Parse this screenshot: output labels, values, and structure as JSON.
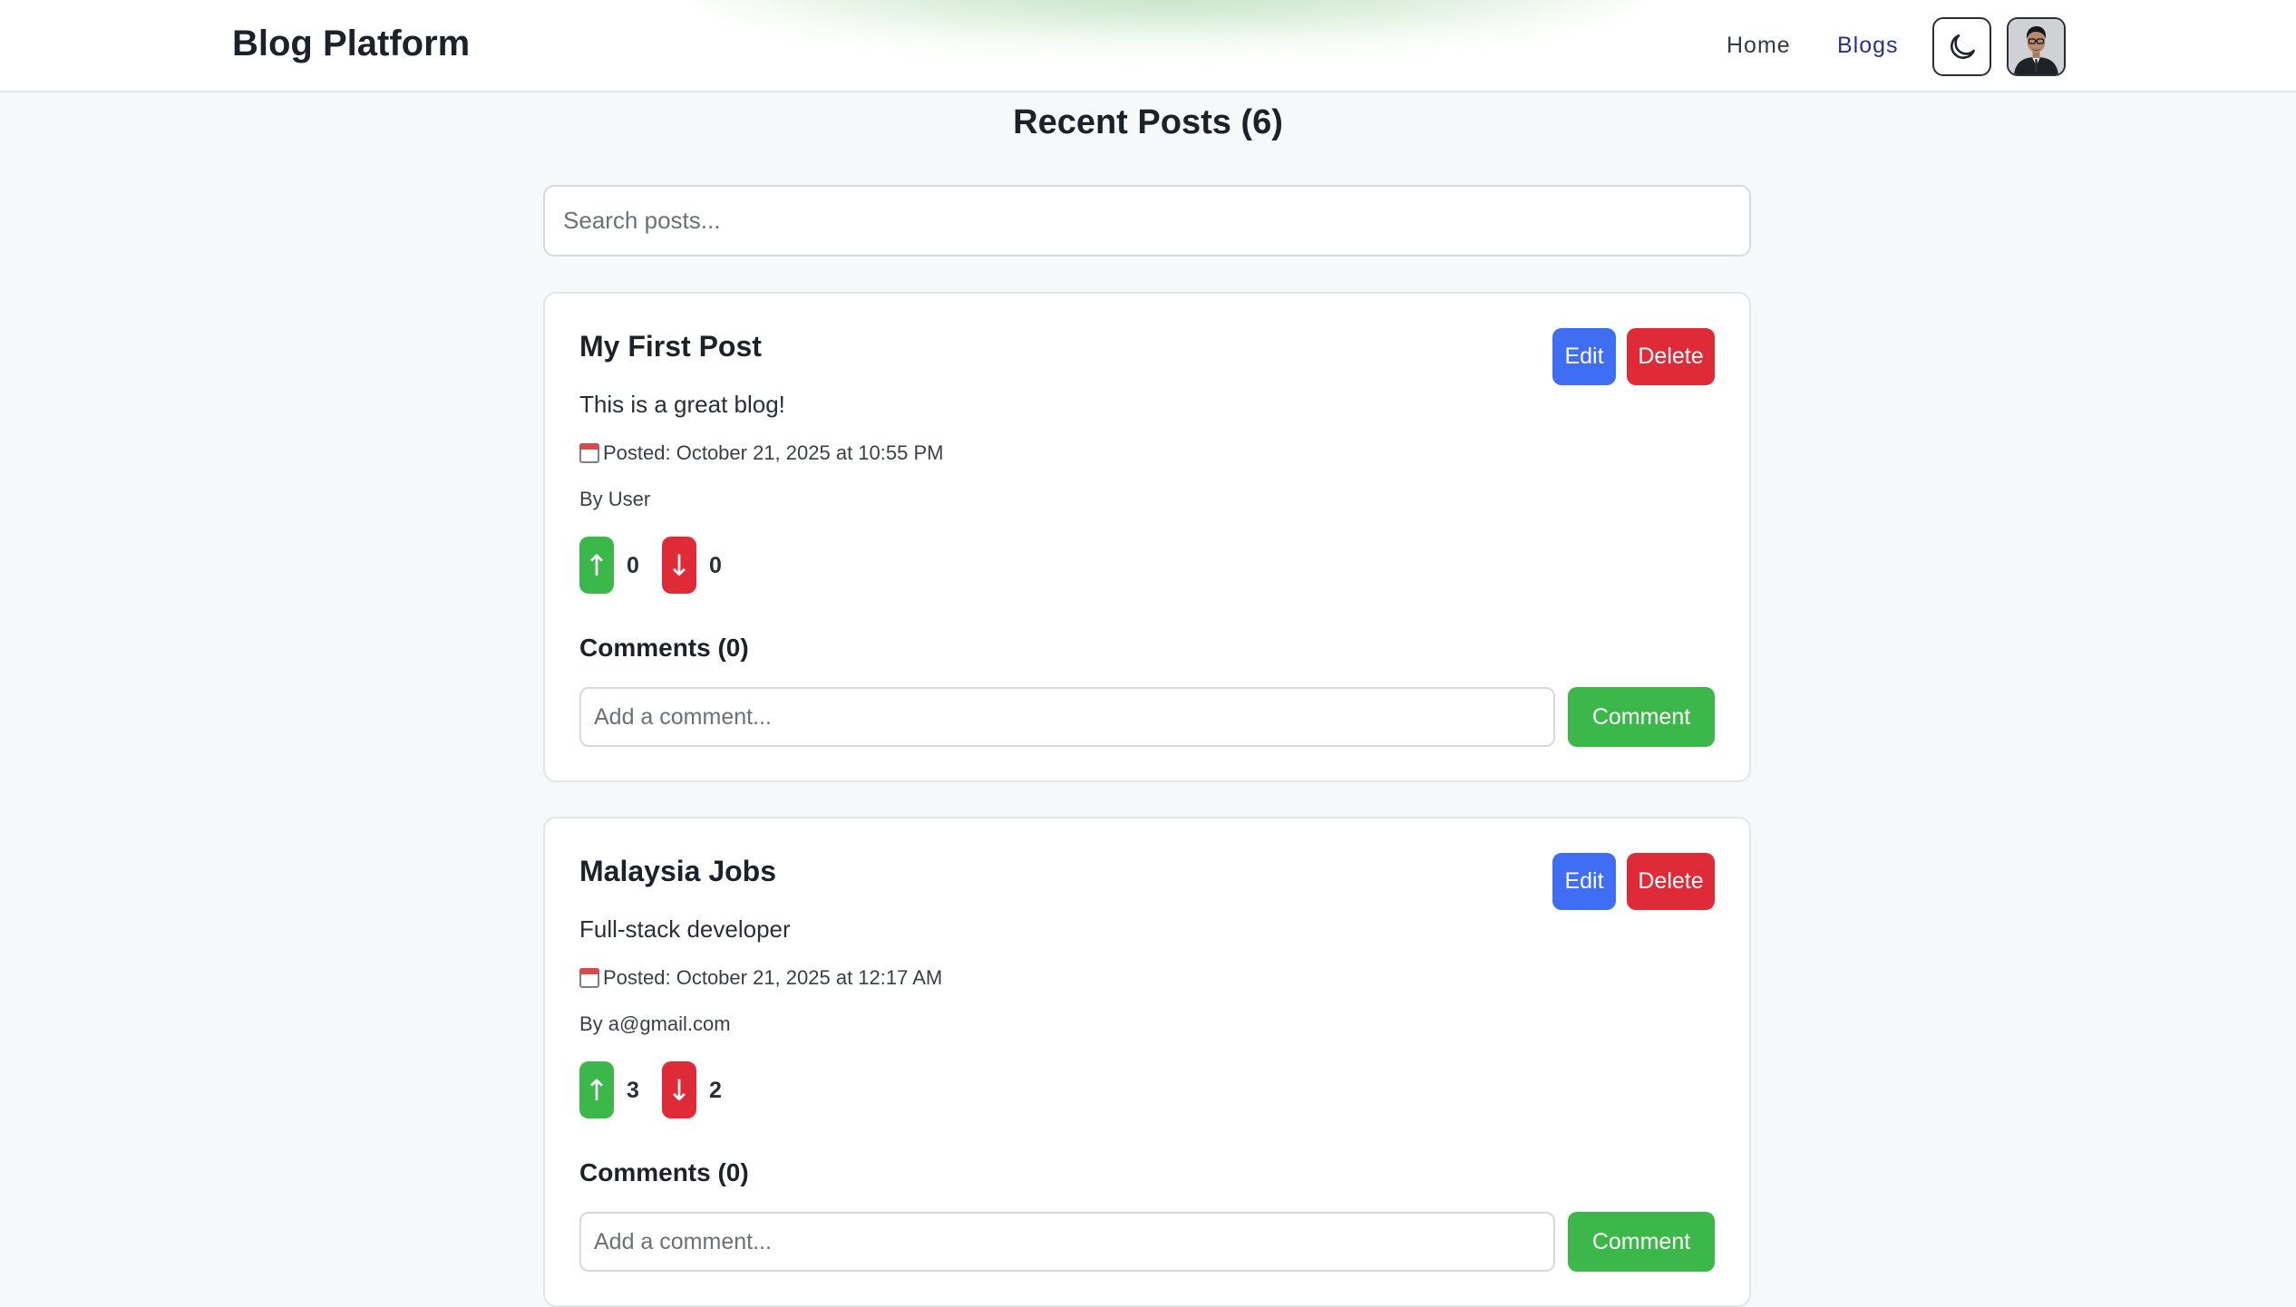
{
  "header": {
    "brand": "Blog Platform",
    "nav": {
      "home": "Home",
      "blogs": "Blogs"
    },
    "theme_toggle_icon": "moon-icon",
    "avatar_icon": "user-avatar"
  },
  "main": {
    "title": "Recent Posts (6)",
    "search_placeholder": "Search posts..."
  },
  "posts": [
    {
      "title": "My First Post",
      "content": "This is a great blog!",
      "date": "Posted: October 21, 2025 at 10:55 PM",
      "author": "By User",
      "upvote_icon": "↑",
      "downvote_icon": "↓",
      "upvotes": "0",
      "downvotes": "0",
      "comments_title": "Comments (0)",
      "comment_placeholder": "Add a comment...",
      "comment_button": "Comment",
      "edit_label": "Edit",
      "delete_label": "Delete"
    },
    {
      "title": "Malaysia Jobs",
      "content": "Full-stack developer",
      "date": "Posted: October 21, 2025 at 12:17 AM",
      "author": "By a@gmail.com",
      "upvote_icon": "↑",
      "downvote_icon": "↓",
      "upvotes": "3",
      "downvotes": "2",
      "comments_title": "Comments (0)",
      "comment_placeholder": "Add a comment...",
      "comment_button": "Comment",
      "edit_label": "Edit",
      "delete_label": "Delete"
    }
  ],
  "colors": {
    "edit": "#3f6ef5",
    "delete": "#df2a37",
    "upvote": "#3cb84a",
    "downvote": "#df2a37",
    "comment": "#3cb84a",
    "nav_active": "#2d2f8f"
  }
}
